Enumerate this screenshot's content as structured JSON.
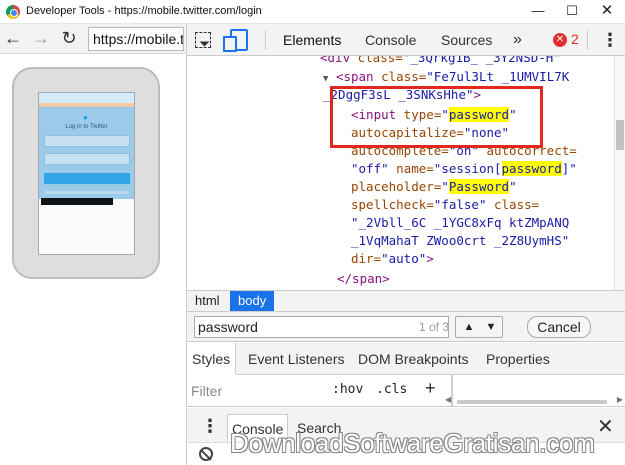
{
  "window": {
    "title": "Developer Tools - https://mobile.twitter.com/login",
    "minimize": "—",
    "maximize": "☐",
    "close": "✕"
  },
  "browser": {
    "url": "https://mobile.twitter.com/login",
    "back_icon": "arrow-left-icon",
    "forward_icon": "arrow-right-icon",
    "reload_icon": "reload-icon"
  },
  "preview": {
    "heading": "Log in to Twitter"
  },
  "devtools": {
    "tabs": [
      "Elements",
      "Console",
      "Sources"
    ],
    "more": "»",
    "error_count": "2",
    "error_icon": "✕",
    "kebab": "⋮"
  },
  "elements_tree": {
    "line1": {
      "tag_open": "<div",
      "attr": " class=",
      "value": "\"_3Qrkg1B_ _3Y2NSD-H\""
    },
    "line2": {
      "tag_open": "<span",
      "attr": " class=",
      "value": "\"Fe7ul3Lt _1UMVIL7K"
    },
    "line3": {
      "value": "_2DggF3sL _3SNKsHhe\"",
      "tag_close": ">"
    },
    "line4": {
      "tag_open": "<input",
      "attr": " type=",
      "quote_open": "\"",
      "value": "password",
      "quote_close": "\""
    },
    "line5": {
      "attr": "autocapitalize=",
      "value": "\"none\""
    },
    "line6": {
      "attr": "autocomplete=",
      "value": "\"on\"",
      "attr2": " autocorrect="
    },
    "line7": {
      "value": "\"off\"",
      "attr": " name=",
      "value2_open": "\"session[",
      "value_hl": "password",
      "value2_close": "]\""
    },
    "line8": {
      "attr": "placeholder=",
      "quote_open": "\"",
      "value_hl": "Password",
      "quote_close": "\""
    },
    "line9": {
      "attr": "spellcheck=",
      "value": "\"false\"",
      "attr2": " class="
    },
    "line10": {
      "value": "\"_2Vbll_6C _1YGC8xFq ktZMpANQ"
    },
    "line11": {
      "value": "_1VqMahaT ZWoo0crt _2Z8UymHS\""
    },
    "line12": {
      "attr": "dir=",
      "value": "\"auto\"",
      "tag_close": ">"
    },
    "line13": {
      "tag": "</span>"
    }
  },
  "breadcrumbs": [
    "html",
    "body"
  ],
  "search": {
    "value": "password",
    "count": "1 of 3",
    "up": "▲",
    "down": "▼",
    "cancel": "Cancel"
  },
  "styles_tabs": [
    "Styles",
    "Event Listeners",
    "DOM Breakpoints",
    "Properties"
  ],
  "filter": {
    "placeholder": "Filter",
    "hov": ":hov",
    "cls": ".cls",
    "add": "+"
  },
  "drawer": {
    "tabs": [
      "Console",
      "Search"
    ],
    "close": "✕",
    "kebab": "⋮"
  },
  "watermark": "DownloadSoftwareGratisan.com"
}
